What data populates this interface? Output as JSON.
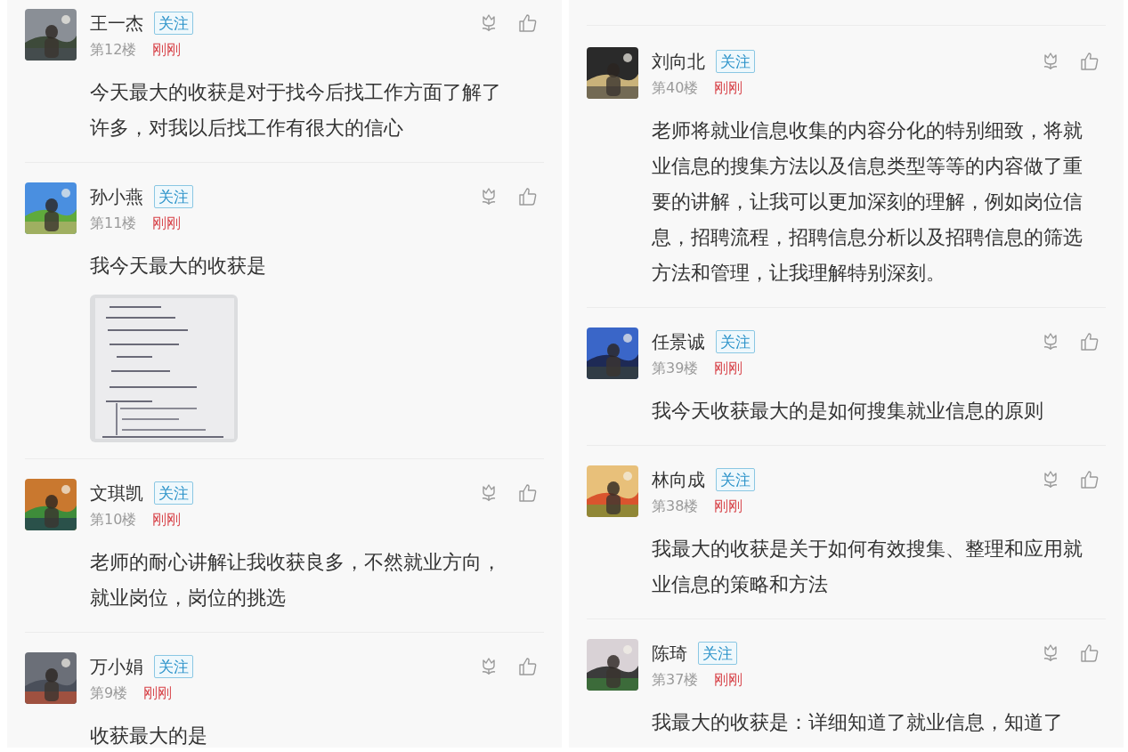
{
  "panels": [
    {
      "comments": [
        {
          "name": "王一杰",
          "follow": "关注",
          "floor": "第12楼",
          "time": "刚刚",
          "body": "今天最大的收获是对于找今后找工作方面了解了许多，对我以后找工作有很大的信心"
        },
        {
          "name": "孙小燕",
          "follow": "关注",
          "floor": "第11楼",
          "time": "刚刚",
          "body": "我今天最大的收获是"
        },
        {
          "name": "文琪凯",
          "follow": "关注",
          "floor": "第10楼",
          "time": "刚刚",
          "body": "老师的耐心讲解让我收获良多，不然就业方向，就业岗位，岗位的挑选"
        },
        {
          "name": "万小娟",
          "follow": "关注",
          "floor": "第9楼",
          "time": "刚刚",
          "body": "收获最大的是"
        }
      ]
    },
    {
      "comments": [
        {
          "name": "刘向北",
          "follow": "关注",
          "floor": "第40楼",
          "time": "刚刚",
          "body": "老师将就业信息收集的内容分化的特别细致，将就业信息的搜集方法以及信息类型等等的内容做了重要的讲解，让我可以更加深刻的理解，例如岗位信息，招聘流程，招聘信息分析以及招聘信息的筛选方法和管理，让我理解特别深刻。"
        },
        {
          "name": "任景诚",
          "follow": "关注",
          "floor": "第39楼",
          "time": "刚刚",
          "body": "我今天收获最大的是如何搜集就业信息的原则"
        },
        {
          "name": "林向成",
          "follow": "关注",
          "floor": "第38楼",
          "time": "刚刚",
          "body": "我最大的收获是关于如何有效搜集、整理和应用就业信息的策略和方法"
        },
        {
          "name": "陈琦",
          "follow": "关注",
          "floor": "第37楼",
          "time": "刚刚",
          "body": "我最大的收获是：详细知道了就业信息，知道了"
        }
      ]
    }
  ]
}
